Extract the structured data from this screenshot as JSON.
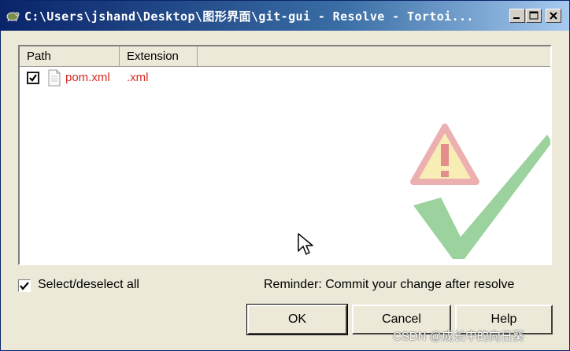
{
  "window": {
    "title": "C:\\Users\\jshand\\Desktop\\图形界面\\git-gui - Resolve - Tortoi...",
    "controls": [
      "minimize-icon",
      "maximize-icon",
      "close-icon"
    ]
  },
  "list": {
    "columns": [
      "Path",
      "Extension"
    ],
    "rows": [
      {
        "checked": true,
        "icon": "file-icon",
        "path": "pom.xml",
        "extension": ".xml"
      }
    ],
    "watermark_icon": "resolve-warning-check-icon"
  },
  "select_all": {
    "checked": true,
    "label": "Select/deselect all"
  },
  "reminder": "Reminder: Commit your change after resolve",
  "buttons": {
    "ok": "OK",
    "cancel": "Cancel",
    "help": "Help"
  },
  "credit": "CSDN @成长中的向日葵",
  "colors": {
    "title_start": "#0a246a",
    "title_end": "#a6caf0",
    "conflict_text": "#d42a20",
    "dialog_bg": "#ece9d8"
  }
}
